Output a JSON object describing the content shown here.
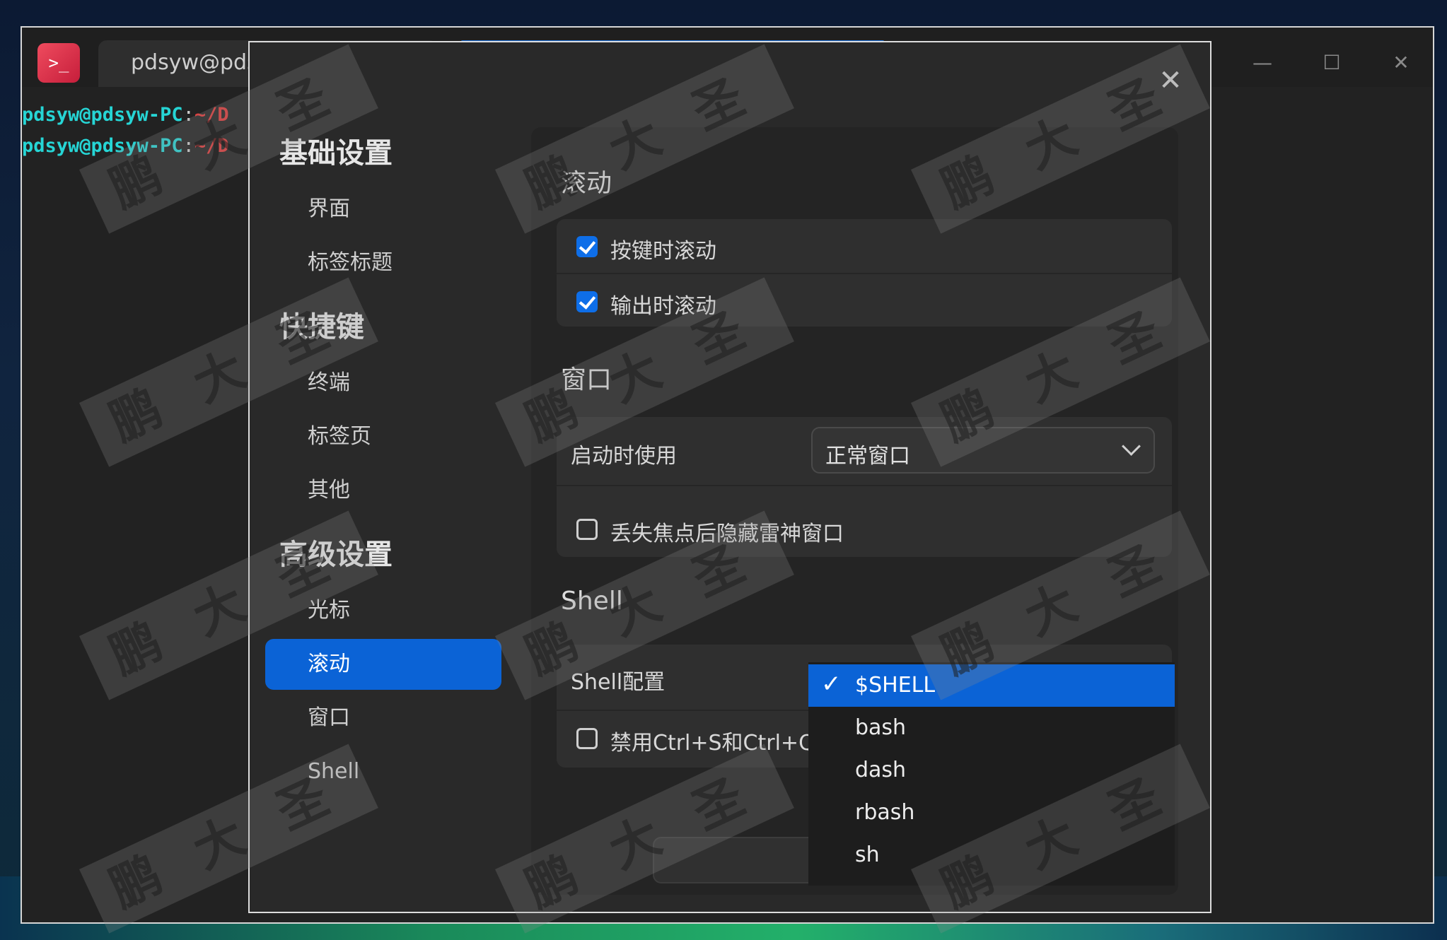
{
  "terminal": {
    "tab_title": "pdsyw@pdsy",
    "lines": [
      {
        "user": "pdsyw@pdsyw-PC",
        "colon": ":",
        "path": "~/D"
      },
      {
        "user": "pdsyw@pdsyw-PC",
        "colon": ":",
        "path": "~/D"
      }
    ],
    "window_buttons": {
      "minimize": "—",
      "maximize": "☐",
      "close": "✕"
    }
  },
  "dialog": {
    "close": "✕",
    "nav": {
      "group_basic": "基础设置",
      "item_interface": "界面",
      "item_tab_title": "标签标题",
      "group_shortcuts": "快捷键",
      "item_terminal": "终端",
      "item_tab_page": "标签页",
      "item_other": "其他",
      "group_advanced": "高级设置",
      "item_cursor": "光标",
      "item_scroll": "滚动",
      "item_window": "窗口",
      "item_shell": "Shell"
    },
    "scroll": {
      "title": "滚动",
      "on_key": "按键时滚动",
      "on_output": "输出时滚动"
    },
    "window": {
      "title": "窗口",
      "startup_label": "启动时使用",
      "startup_value": "正常窗口",
      "hide_on_blur": "丢失焦点后隐藏雷神窗口"
    },
    "shell": {
      "title": "Shell",
      "config_label": "Shell配置",
      "disable_ctrl": "禁用Ctrl+S和Ctrl+Q控制"
    },
    "dropdown": {
      "options": [
        "$SHELL",
        "bash",
        "dash",
        "rbash",
        "sh"
      ],
      "selected": "$SHELL",
      "check": "✓"
    }
  },
  "watermark_text": "鹏大圣",
  "colors": {
    "accent": "#0b63d6",
    "prompt_user": "#26d5d5",
    "prompt_path": "#e03a3a"
  }
}
